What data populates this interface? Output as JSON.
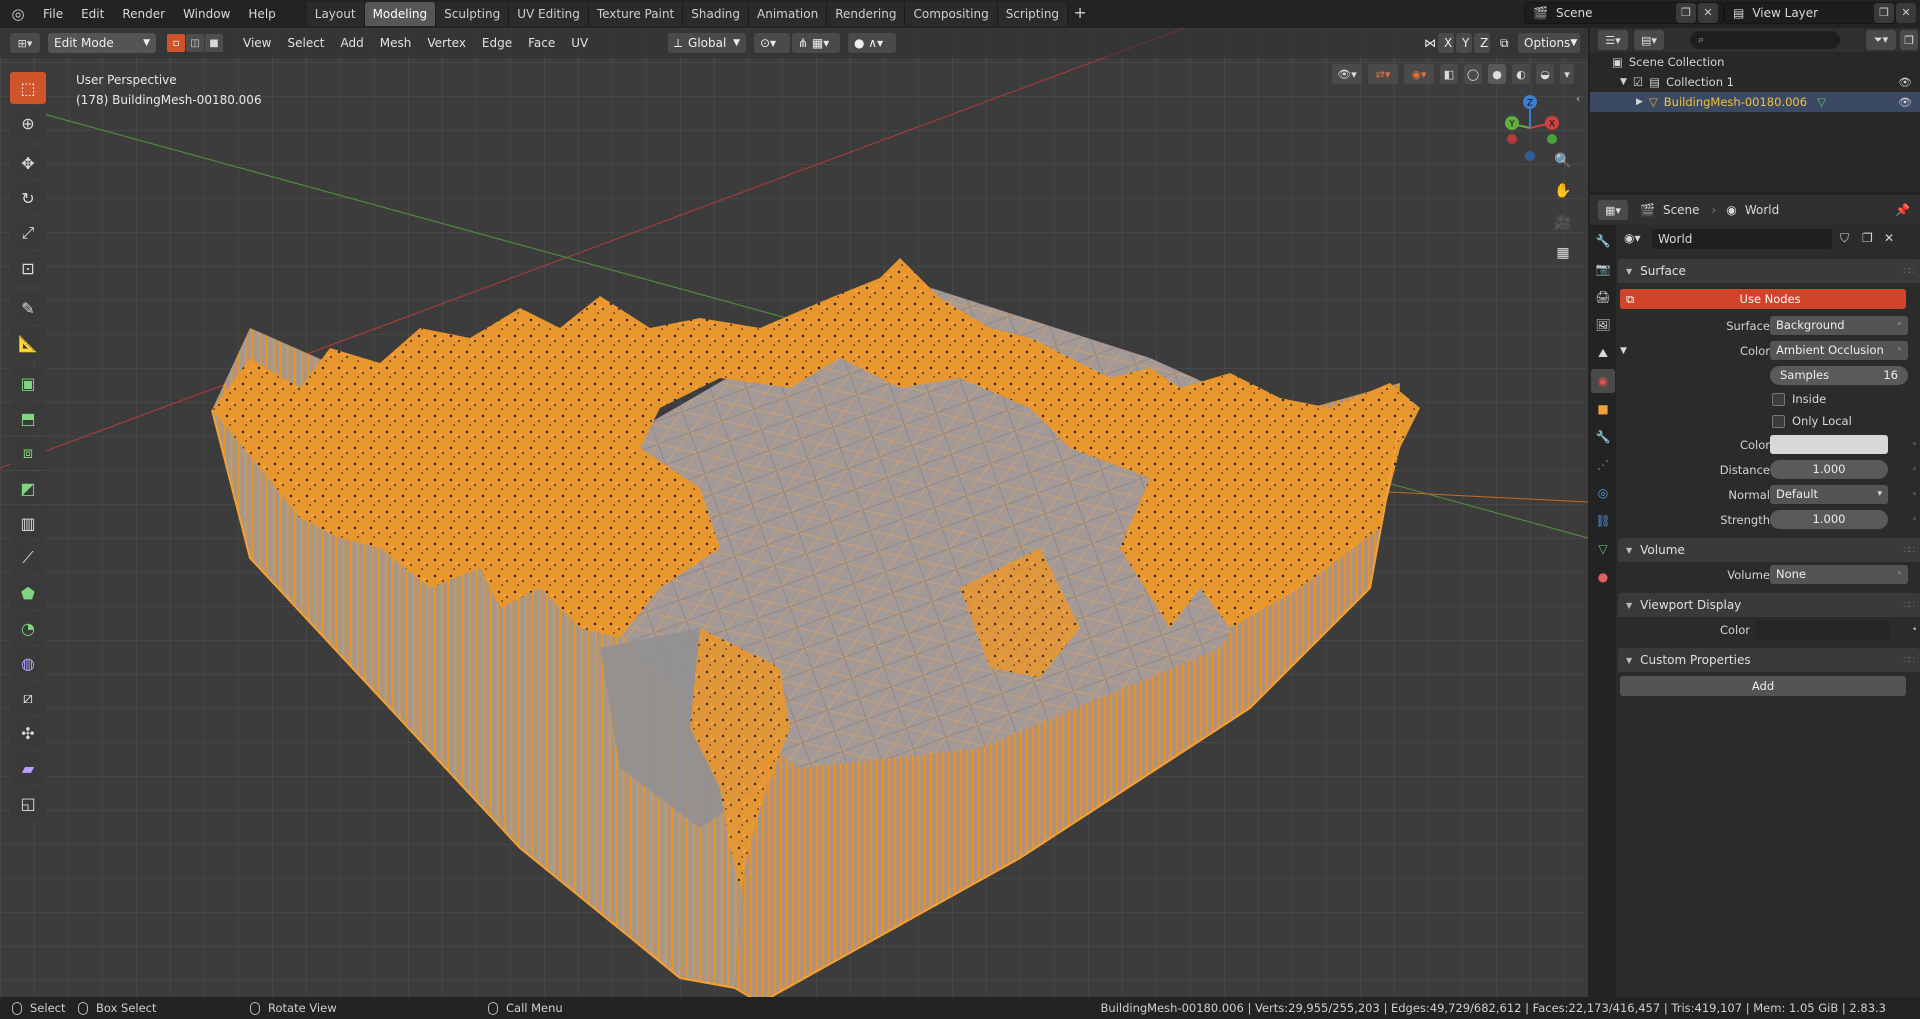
{
  "top_menu": {
    "items": [
      "File",
      "Edit",
      "Render",
      "Window",
      "Help"
    ],
    "workspaces": [
      "Layout",
      "Modeling",
      "Sculpting",
      "UV Editing",
      "Texture Paint",
      "Shading",
      "Animation",
      "Rendering",
      "Compositing",
      "Scripting"
    ],
    "active_workspace": "Modeling",
    "scene_name": "Scene",
    "view_layer_name": "View Layer"
  },
  "viewport": {
    "mode": "Edit Mode",
    "menus": [
      "View",
      "Select",
      "Add",
      "Mesh",
      "Vertex",
      "Edge",
      "Face",
      "UV"
    ],
    "transform_orientation": "Global",
    "axes": [
      "X",
      "Y",
      "Z"
    ],
    "options_label": "Options",
    "view_name": "User Perspective",
    "object_info": "(178) BuildingMesh-00180.006",
    "gizmo_labels": [
      "Z",
      "Y",
      "X"
    ]
  },
  "toolbar": {
    "tools": [
      "select-box",
      "cursor",
      "move",
      "rotate",
      "scale",
      "transform",
      "annotate",
      "measure",
      "add-cube",
      "extrude",
      "inset",
      "bevel",
      "loop-cut",
      "knife",
      "poly-build",
      "spin",
      "smooth",
      "edge-slide",
      "shrink-fatten",
      "shear",
      "rip"
    ]
  },
  "outliner": {
    "root": "Scene Collection",
    "collection": "Collection 1",
    "object": "BuildingMesh-00180.006"
  },
  "properties": {
    "breadcrumb_scene": "Scene",
    "breadcrumb_world": "World",
    "world_name": "World",
    "surface_panel": "Surface",
    "use_nodes": "Use Nodes",
    "surface_label": "Surface",
    "surface_value": "Background",
    "color_label": "Color",
    "color_value": "Ambient Occlusion",
    "samples_label": "Samples",
    "samples_value": "16",
    "inside_label": "Inside",
    "only_local_label": "Only Local",
    "color2_label": "Color",
    "distance_label": "Distance",
    "distance_value": "1.000",
    "normal_label": "Normal",
    "normal_value": "Default",
    "strength_label": "Strength",
    "strength_value": "1.000",
    "volume_panel": "Volume",
    "volume_label": "Volume",
    "volume_value": "None",
    "viewport_display_panel": "Viewport Display",
    "vd_color_label": "Color",
    "custom_props_panel": "Custom Properties",
    "add_label": "Add"
  },
  "statusbar": {
    "select": "Select",
    "box_select": "Box Select",
    "rotate_view": "Rotate View",
    "call_menu": "Call Menu",
    "stats": "BuildingMesh-00180.006 | Verts:29,955/255,203 | Edges:49,729/682,612 | Faces:22,173/416,457 | Tris:419,107 | Mem: 1.05 GiB | 2.83.3"
  },
  "colors": {
    "accent": "#d0542a",
    "selection": "#f5a030",
    "mesh_face": "#9a9a9a",
    "background": "#3c3c3c"
  }
}
